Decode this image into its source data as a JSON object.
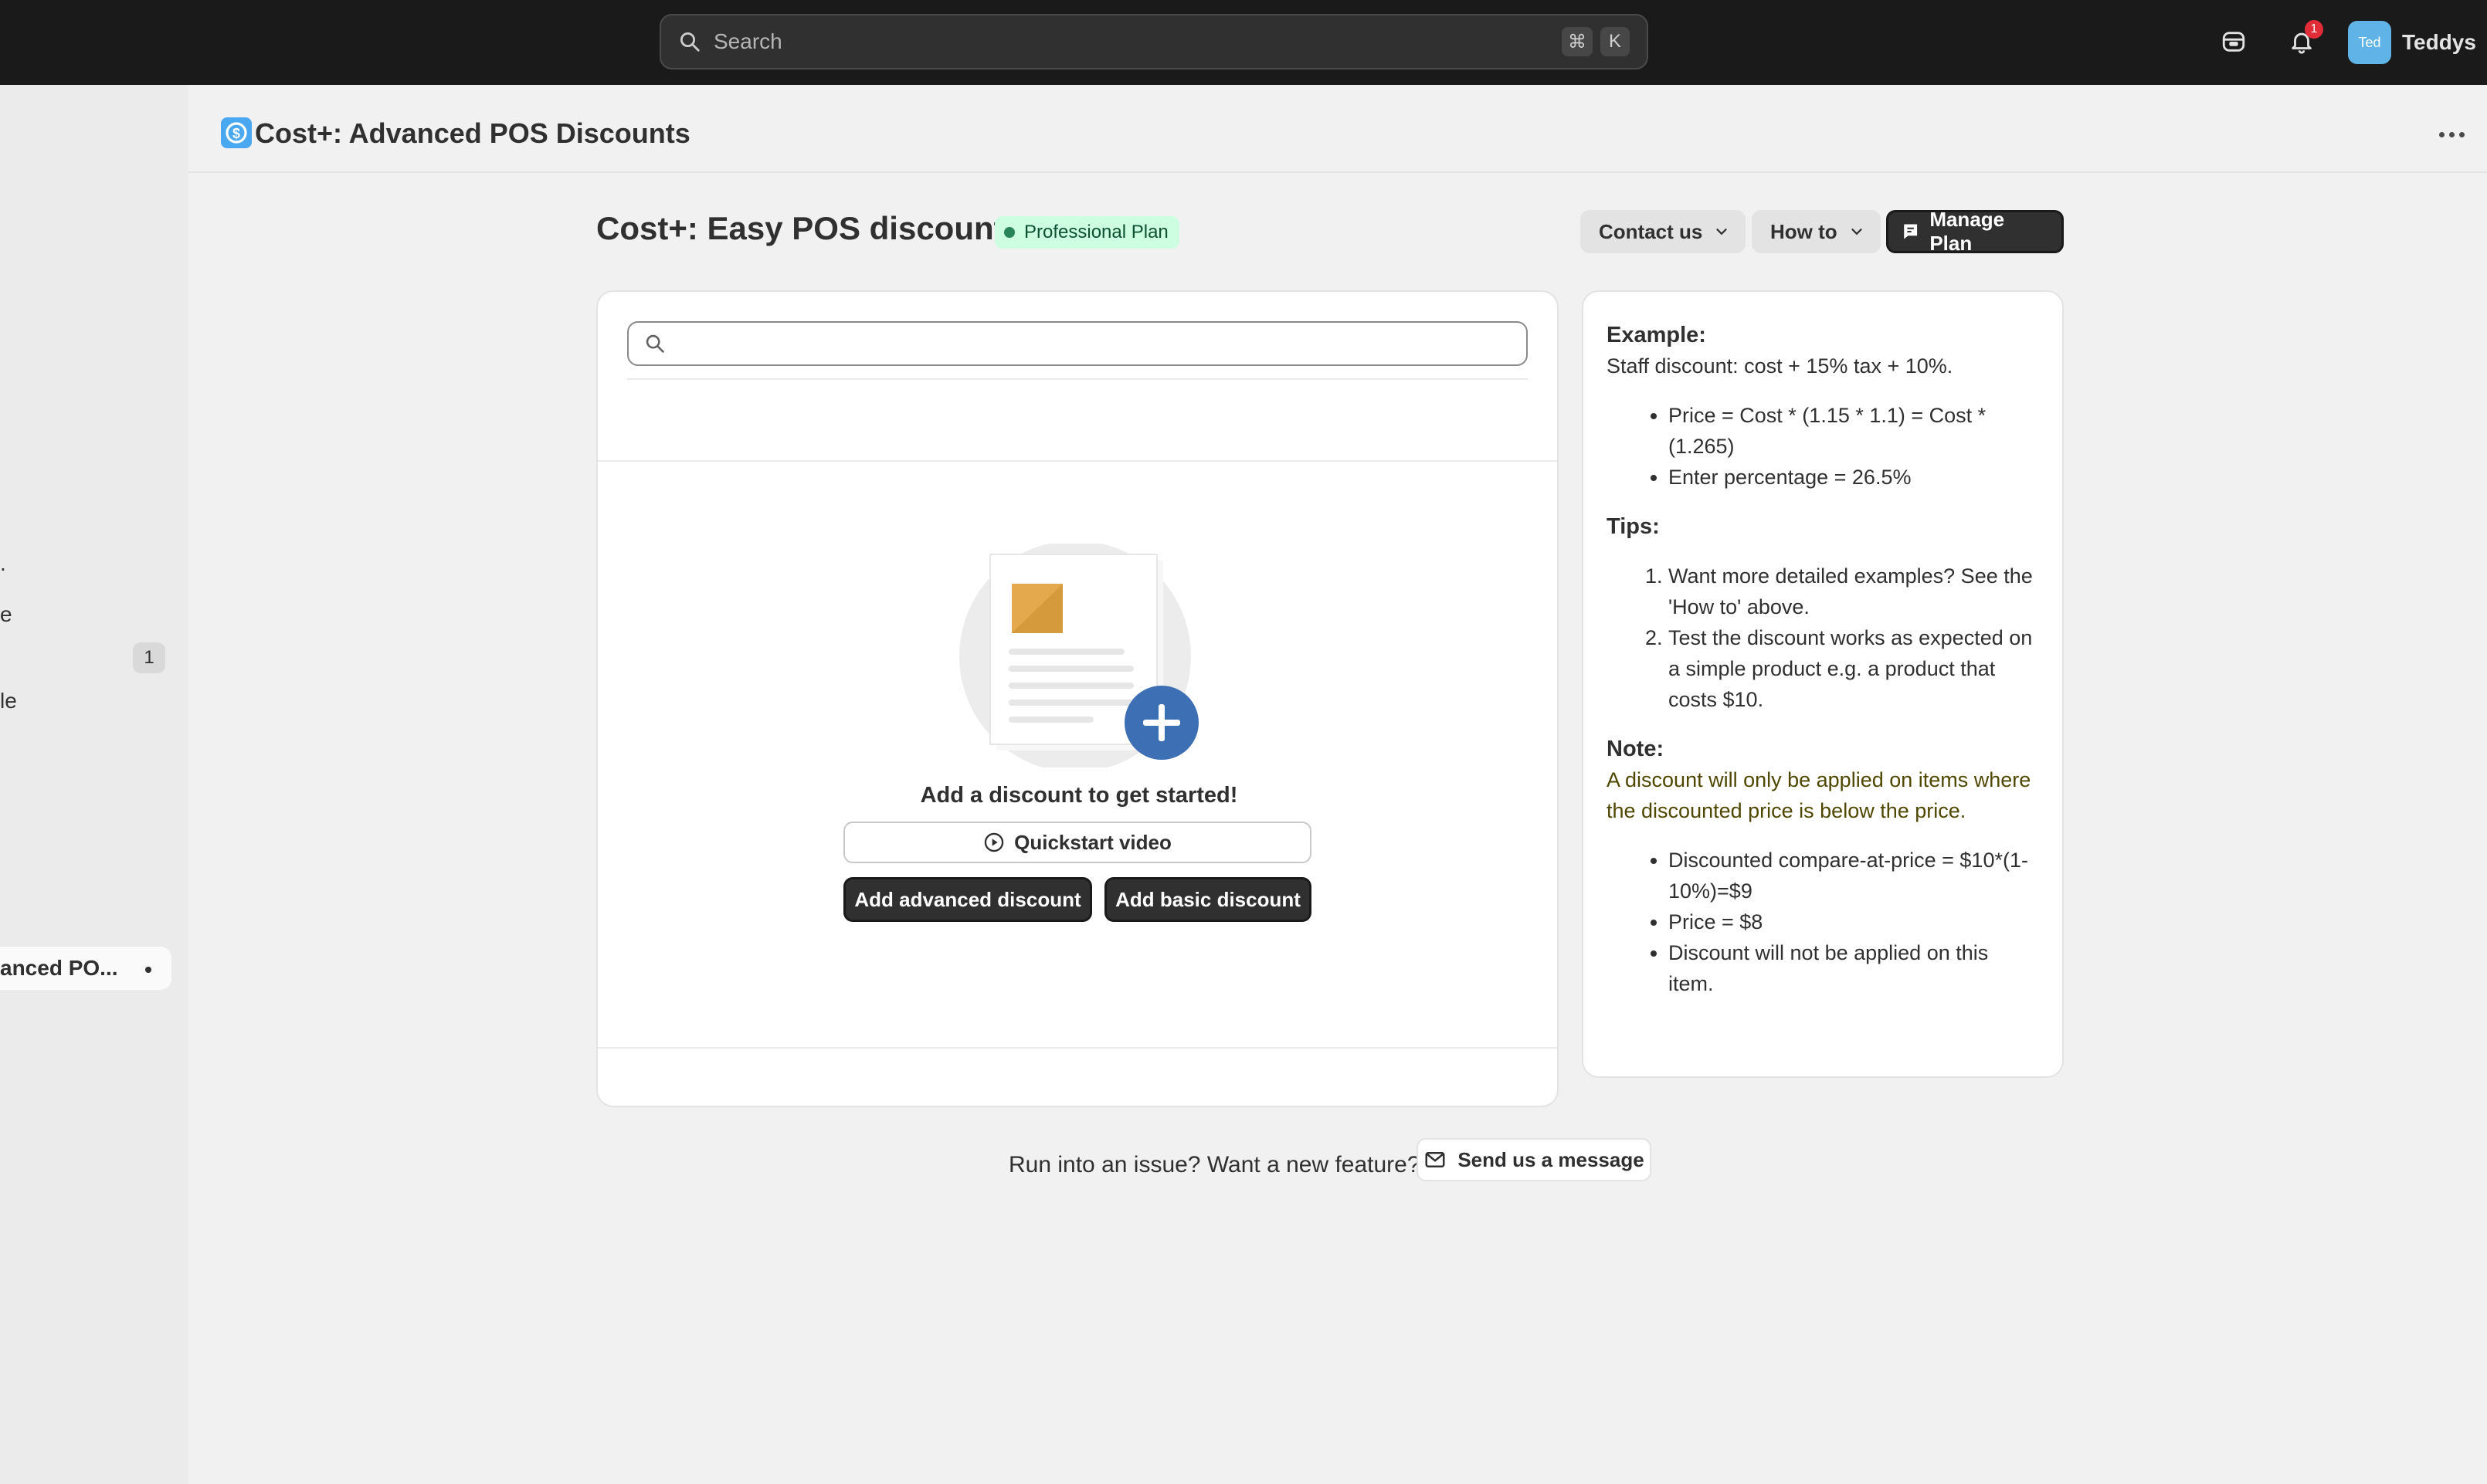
{
  "topbar": {
    "search_placeholder": "Search",
    "shortcut_keys": [
      "⌘",
      "K"
    ],
    "notification_count": "1",
    "user": {
      "avatar_text": "Ted",
      "name": "Teddys"
    }
  },
  "sidebar": {
    "partial_items": [
      ".",
      "e",
      "le"
    ],
    "count_badge": "1",
    "active_item": "anced PO..."
  },
  "app": {
    "title": "Cost+: Advanced POS Discounts"
  },
  "page": {
    "title": "Cost+: Easy POS discount",
    "plan_badge": "Professional Plan",
    "contact_label": "Contact us",
    "howto_label": "How to",
    "manage_plan_label": "Manage Plan"
  },
  "main_card": {
    "search_placeholder": "",
    "empty_heading": "Add a discount to get started!",
    "quickstart_label": "Quickstart video",
    "add_advanced_label": "Add advanced discount",
    "add_basic_label": "Add basic discount"
  },
  "info_card": {
    "example_heading": "Example:",
    "example_text": "Staff discount: cost + 15% tax + 10%.",
    "example_items": [
      "Price = Cost * (1.15 * 1.1) = Cost * (1.265)",
      "Enter percentage = 26.5%"
    ],
    "tips_heading": "Tips:",
    "tips_items": [
      "Want more detailed examples? See the 'How to' above.",
      "Test the discount works as expected on a simple product e.g. a product that costs $10."
    ],
    "note_heading": "Note:",
    "note_text": "A discount will only be applied on items where the discounted price is below the price.",
    "note_items": [
      "Discounted compare-at-price = $10*(1-10%)=$9",
      "Price = $8",
      "Discount will not be applied on this item."
    ]
  },
  "footer": {
    "text": "Run into an issue? Want a new feature?",
    "send_label": "Send us a message"
  },
  "colors": {
    "topbar": "#1a1a1a",
    "primary_button": "#303030",
    "plan_badge_bg": "#cdfee1",
    "note_text": "#4f4700",
    "notification": "#e22c38"
  }
}
